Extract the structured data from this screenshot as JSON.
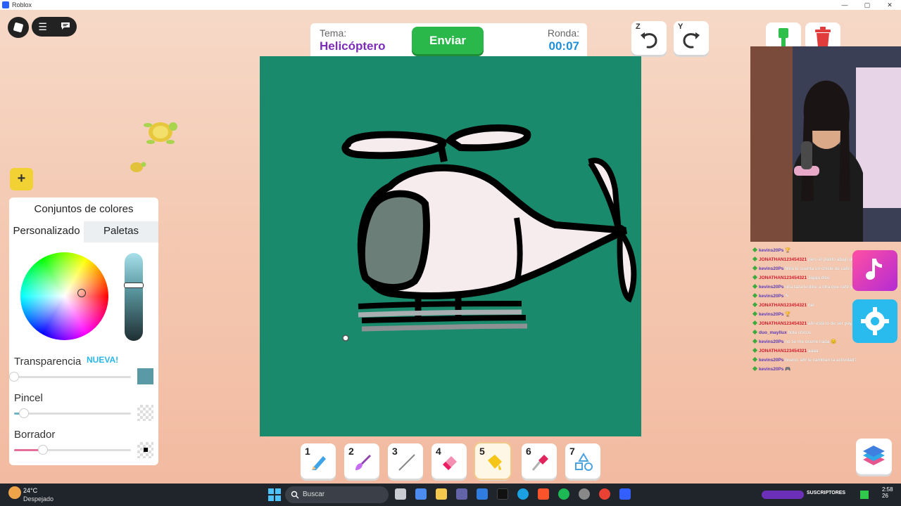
{
  "window": {
    "title": "Roblox"
  },
  "window_controls": {
    "minimize": "—",
    "maximize": "▢",
    "close": "✕"
  },
  "topbar": {
    "tema_label": "Tema:",
    "tema_value": "Helicóptero",
    "enviar_label": "Enviar",
    "ronda_label": "Ronda:",
    "ronda_value": "00:07"
  },
  "undo": {
    "key": "Z"
  },
  "redo": {
    "key": "Y"
  },
  "plus_label": "+",
  "color_panel": {
    "title": "Conjuntos de colores",
    "tabs": [
      "Personalizado",
      "Paletas"
    ],
    "transparency_label": "Transparencia",
    "new_badge": "NUEVA!",
    "brush_label": "Pincel",
    "eraser_label": "Borrador",
    "selected_color": "#5a9aa6"
  },
  "tools": [
    {
      "num": "1",
      "icon": "pencil-icon"
    },
    {
      "num": "2",
      "icon": "brush-icon"
    },
    {
      "num": "3",
      "icon": "line-icon"
    },
    {
      "num": "4",
      "icon": "eraser-icon"
    },
    {
      "num": "5",
      "icon": "fill-bucket-icon",
      "active": true
    },
    {
      "num": "6",
      "icon": "eyedropper-icon"
    },
    {
      "num": "7",
      "icon": "shapes-icon"
    }
  ],
  "chat": [
    {
      "user": "kevins20Ps",
      "type": "u1",
      "msg": "🏆"
    },
    {
      "user": "JONATHAN123454321",
      "type": "u2",
      "msg": "pero el platito abajo de la taza"
    },
    {
      "user": "kevins20Ps",
      "type": "u1",
      "msg": "Mira le cuenta un chiste de café y lo"
    },
    {
      "user": "JONATHAN123454321",
      "type": "u2",
      "msg": "Jajaja dice"
    },
    {
      "user": "kevins20Ps",
      "type": "u1",
      "msg": "una taza le dice a otra que café y el responde café"
    },
    {
      "user": "kevins20Ps",
      "type": "u1",
      "msg": "✎"
    },
    {
      "user": "JONATHAN123454321",
      "type": "u2",
      "msg": "nel"
    },
    {
      "user": "kevins20Ps",
      "type": "u1",
      "msg": "🏆"
    },
    {
      "user": "JONATHAN123454321",
      "type": "u2",
      "msg": "ahí está lo de ser payaso"
    },
    {
      "user": "duo_mayllux",
      "type": "u1",
      "msg": "hola chicos"
    },
    {
      "user": "kevins20Ps",
      "type": "u1",
      "msg": "no se me ocurre nada 😊"
    },
    {
      "user": "JONATHAN123454321",
      "type": "u2",
      "msg": "aaaa"
    },
    {
      "user": "kevins20Ps",
      "type": "u1",
      "msg": "bueno, ahí le cambian la actividad?"
    },
    {
      "user": "kevins20Ps",
      "type": "u1",
      "msg": "🎮"
    }
  ],
  "taskbar": {
    "weather_temp": "24°C",
    "weather_desc": "Despejado",
    "search_placeholder": "Buscar",
    "tray_label": "SUSCRIPTORES",
    "time": "2:58",
    "date_fragment": "26"
  }
}
